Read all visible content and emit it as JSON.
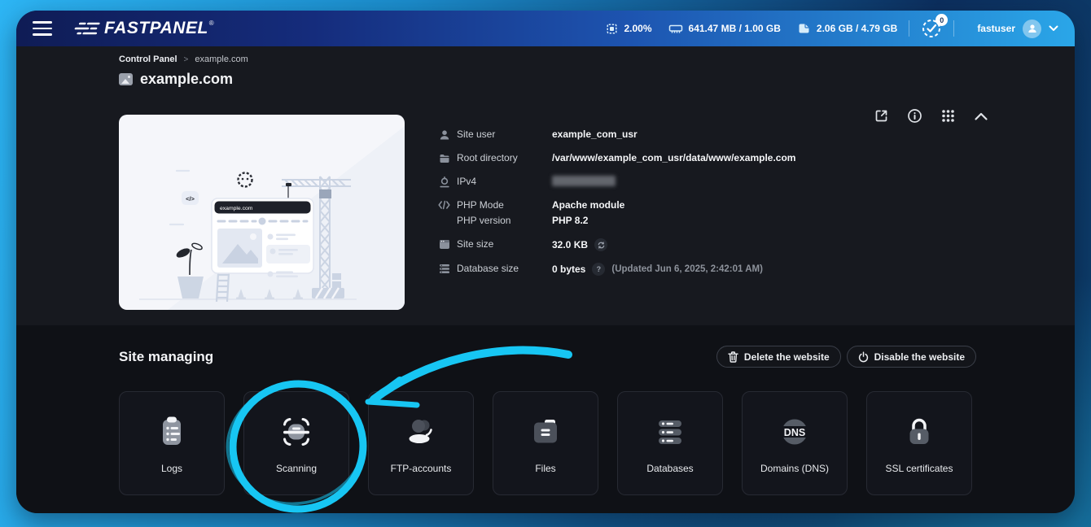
{
  "topbar": {
    "brand": "FASTPANEL",
    "brand_reg": "®",
    "stats": [
      {
        "icon": "cpu-icon",
        "value": "2.00%"
      },
      {
        "icon": "ram-icon",
        "value": "641.47 MB / 1.00 GB"
      },
      {
        "icon": "disk-icon",
        "value": "2.06 GB / 4.79 GB"
      }
    ],
    "notifications_count": "0",
    "username": "fastuser"
  },
  "header": {
    "breadcrumb": {
      "root": "Control Panel",
      "current": "example.com"
    },
    "title": "example.com"
  },
  "illustration": {
    "browser_url": "example.com",
    "code_badge": "</>"
  },
  "details": {
    "rows": [
      {
        "icon": "user-icon",
        "label": "Site user",
        "value": "example_com_usr"
      },
      {
        "icon": "folder-icon",
        "label": "Root directory",
        "value": "/var/www/example_com_usr/data/www/example.com"
      },
      {
        "icon": "pin-icon",
        "label": "IPv4",
        "value": ""
      },
      {
        "icon": "code-icon",
        "label": "PHP Mode",
        "value": "Apache module",
        "label2": "PHP version",
        "value2": "PHP 8.2"
      },
      {
        "icon": "window-icon",
        "label": "Site size",
        "value": "32.0 KB"
      },
      {
        "icon": "stack-icon",
        "label": "Database size",
        "value": "0 bytes",
        "help": "?",
        "updated": "(Updated Jun 6, 2025, 2:42:01 AM)"
      }
    ]
  },
  "managing": {
    "title": "Site managing",
    "buttons": [
      {
        "icon": "trash-icon",
        "label": "Delete the website"
      },
      {
        "icon": "power-icon",
        "label": "Disable the website"
      }
    ]
  },
  "tiles": [
    {
      "icon": "logs-icon",
      "label": "Logs"
    },
    {
      "icon": "scan-icon",
      "label": "Scanning"
    },
    {
      "icon": "people-icon",
      "label": "FTP-accounts"
    },
    {
      "icon": "folder-icon",
      "label": "Files"
    },
    {
      "icon": "databases-icon",
      "label": "Databases"
    },
    {
      "icon": "dns-icon",
      "label": "Domains (DNS)",
      "icon_text": "DNS"
    },
    {
      "icon": "lock-icon",
      "label": "SSL certificates"
    }
  ],
  "colors": {
    "annotation_accent": "#17c6f3",
    "topbar_gradient_start": "#0f1c55",
    "topbar_gradient_end": "#2aa6e8",
    "section_top_bg": "#17191f",
    "section_bottom_bg": "#0f1116",
    "tile_bg": "#13151c"
  }
}
